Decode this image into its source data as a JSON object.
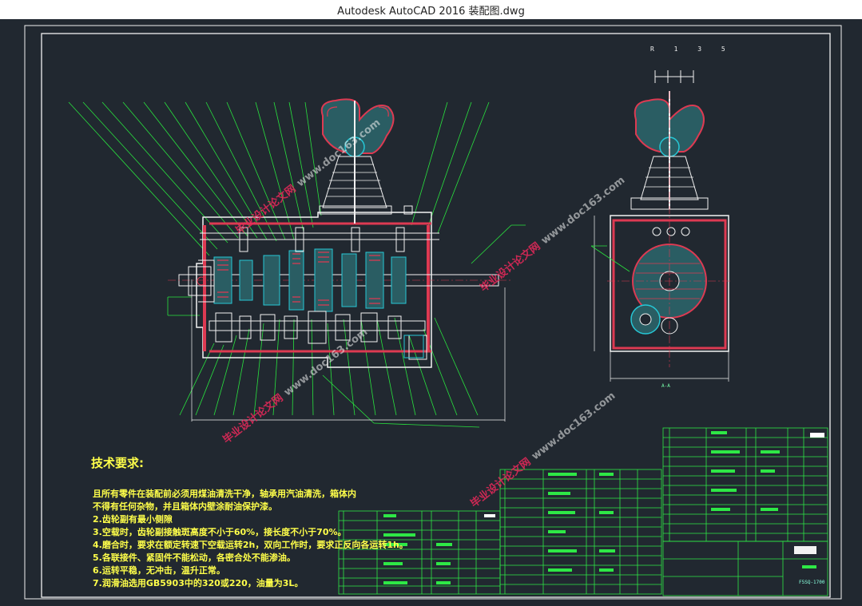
{
  "window": {
    "title": "Autodesk AutoCAD 2016    装配图.dwg"
  },
  "drawing": {
    "shift_pattern_label": "R 1 3 5",
    "section_label": "A-A",
    "title_block_code": "F5SQ-1700",
    "technical_requirements": {
      "title": "技术要求:",
      "lines": [
        "且所有零件在装配前必须用煤油清洗干净，轴承用汽油清洗，箱体内",
        "不得有任何杂物，并且箱体内壁涂耐油保护漆。",
        "2.齿轮副有最小侧隙",
        "3.空载时，齿轮副接触斑高度不小于60%，接长度不小于70%。",
        "4.磨合时，要求在额定转速下空载运转2h，双向工作时，要求正反向各运转1h。",
        "5.各联接件、紧固件不能松动，各密合处不能渗油。",
        "6.运转平稳，无冲击，温升正常。",
        "7.润滑油选用GB5903中的320或220，油量为3L。"
      ]
    },
    "watermark": {
      "cn": "毕业设计论文网",
      "url": "www.doc163.com"
    },
    "colors": {
      "background": "#212830",
      "outline": "#f2f2f2",
      "section_hatch": "#dd3a52",
      "leader": "#29e23e",
      "cyan": "#26c7d6",
      "text_yellow": "#ffff4a",
      "table_green": "#2ee846"
    }
  }
}
